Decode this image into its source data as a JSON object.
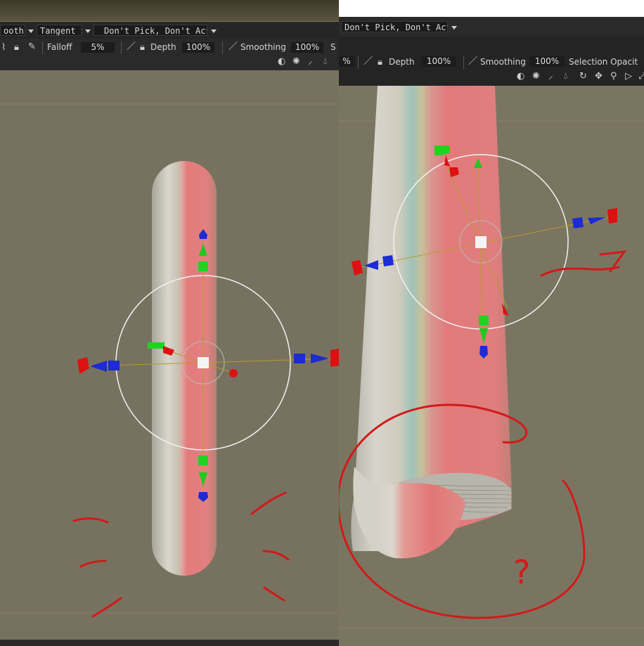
{
  "left_panel": {
    "smooth_dropdown": "ooth",
    "tangent_dropdown": "Tangent S",
    "pick_dropdown": "Don't Pick, Don't Act",
    "falloff_label": "Falloff",
    "falloff_value": "5%",
    "depth_label": "Depth",
    "depth_value": "100%",
    "smoothing_label": "Smoothing",
    "smoothing_value": "100%",
    "cut_label": "S"
  },
  "right_panel": {
    "pick_dropdown": "Don't Pick, Don't Act",
    "partial_value": "%",
    "depth_label": "Depth",
    "depth_value": "100%",
    "smoothing_label": "Smoothing",
    "smoothing_value": "100%",
    "selection_label": "Selection Opacit"
  },
  "annotations": {
    "question_mark": "?"
  },
  "colors": {
    "viewport_bg": "#77725f",
    "toolbar_bg": "#262626",
    "mesh_red": "#e27a7a",
    "mesh_gray": "#c7c3b8",
    "axis_x": "#2233cc",
    "axis_y": "#22cc22",
    "axis_z": "#dd1111",
    "annotation_red": "#d11a1a"
  }
}
